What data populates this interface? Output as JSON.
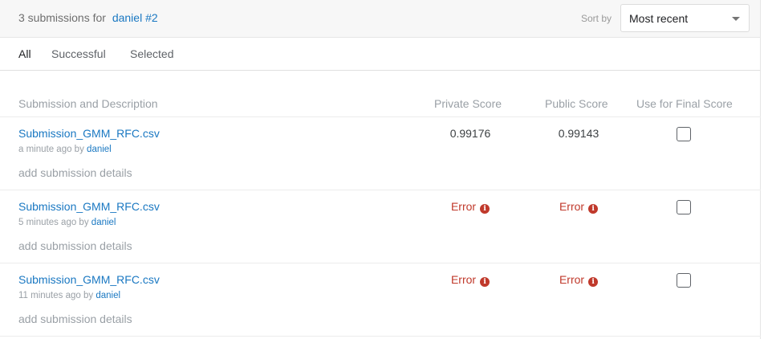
{
  "header": {
    "count_text": "3 submissions for",
    "user": "daniel #2",
    "sort_label": "Sort by",
    "sort_value": "Most recent"
  },
  "tabs": [
    {
      "label": "All",
      "active": true
    },
    {
      "label": "Successful",
      "active": false
    },
    {
      "label": "Selected",
      "active": false
    }
  ],
  "columns": {
    "submission": "Submission and Description",
    "private": "Private Score",
    "public": "Public Score",
    "final": "Use for Final Score"
  },
  "rows": [
    {
      "file": "Submission_GMM_RFC.csv",
      "time": "a minute ago by",
      "user": "daniel",
      "details": "add submission details",
      "private": "0.99176",
      "public": "0.99143",
      "selected": false
    },
    {
      "file": "Submission_GMM_RFC.csv",
      "time": "5 minutes ago by",
      "user": "daniel",
      "details": "add submission details",
      "private": "Error",
      "public": "Error",
      "selected": false
    },
    {
      "file": "Submission_GMM_RFC.csv",
      "time": "11 minutes ago by",
      "user": "daniel",
      "details": "add submission details",
      "private": "Error",
      "public": "Error",
      "selected": false
    }
  ],
  "colors": {
    "link": "#1a78c2",
    "error": "#c0392b"
  }
}
